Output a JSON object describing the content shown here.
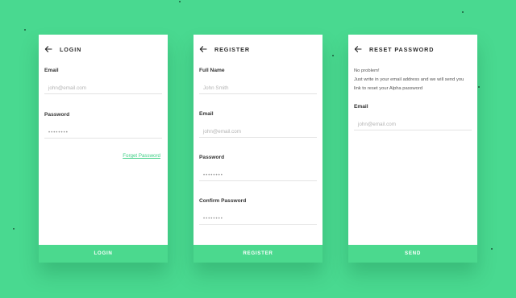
{
  "colors": {
    "background": "#49d990",
    "accent": "#4bd98e",
    "link": "#3ecf85"
  },
  "login": {
    "title": "LOGIN",
    "email_label": "Email",
    "email_placeholder": "john@email.com",
    "password_label": "Password",
    "password_value": "••••••••",
    "forgot_link": "Forget Password",
    "button": "LOGIN"
  },
  "register": {
    "title": "REGISTER",
    "fullname_label": "Full Name",
    "fullname_placeholder": "John Smith",
    "email_label": "Email",
    "email_placeholder": "john@email.com",
    "password_label": "Password",
    "password_value": "••••••••",
    "confirm_label": "Confirm Password",
    "confirm_value": "••••••••",
    "button": "REGISTER"
  },
  "reset": {
    "title": "RESET PASSWORD",
    "message_line1": "No problem!",
    "message_line2": "Just write in your email address and we will send you",
    "message_line3": "link to reset your Alpha password",
    "email_label": "Email",
    "email_placeholder": "john@email.com",
    "button": "SEND"
  },
  "icons": {
    "back": "arrow-left-icon"
  }
}
